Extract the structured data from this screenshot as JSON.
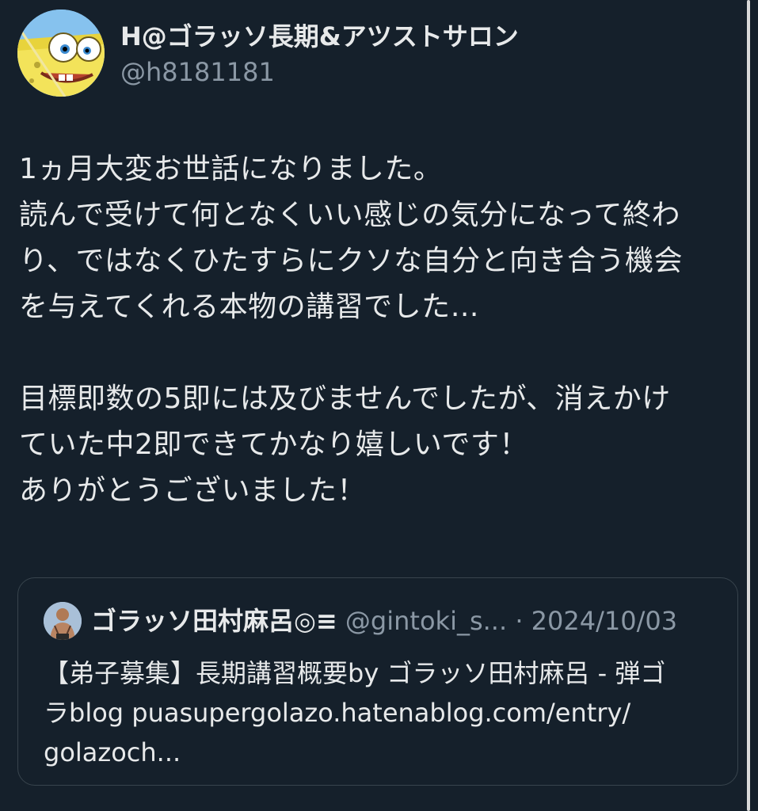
{
  "author": {
    "display_name": "H@ゴラッソ長期&アツストサロン",
    "handle": "@h8181181",
    "avatar_icon": "cartoon-sponge-avatar"
  },
  "tweet": {
    "lines": [
      "1ヵ月大変お世話になりました。",
      "読んで受けて何となくいい感じの気分になって終わ",
      "り、ではなくひたすらにクソな自分と向き合う機会",
      "を与えてくれる本物の講習でした…",
      "",
      "目標即数の5即には及びませんでしたが、消えかけ",
      "ていた中2即できてかなり嬉しいです！",
      "ありがとうございました！"
    ]
  },
  "quote": {
    "display_name": "ゴラッソ田村麻呂◎≡",
    "handle": "@gintoki_s...",
    "separator": " · ",
    "date": "2024/10/03",
    "lines": [
      "【弟子募集】長期講習概要by ゴラッソ田村麻呂 - 弾ゴ",
      "ラblog puasupergolazo.hatenablog.com/entry/",
      "golazoch..."
    ]
  },
  "colors": {
    "background": "#15202b",
    "primary_text": "#e7e9ea",
    "secondary_text": "#8b98a5",
    "border": "#38444d"
  }
}
